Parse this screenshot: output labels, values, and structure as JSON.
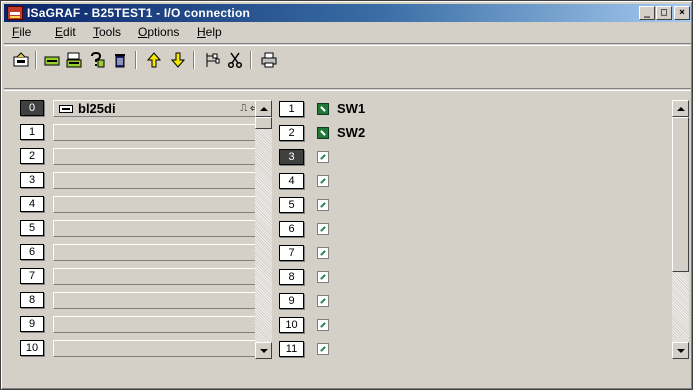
{
  "window": {
    "title": "ISaGRAF - B25TEST1 - I/O connection",
    "controls": {
      "minimize": "_",
      "maximize": "□",
      "close": "×"
    }
  },
  "menu": {
    "items": [
      {
        "label": "File",
        "underline": "F"
      },
      {
        "label": "Edit",
        "underline": "E"
      },
      {
        "label": "Tools",
        "underline": "T"
      },
      {
        "label": "Options",
        "underline": "O"
      },
      {
        "label": "Help",
        "underline": "H"
      }
    ]
  },
  "toolbar": {
    "icons": [
      "set-board-icon",
      "board-params-icon",
      "board-open-icon",
      "board-test-icon",
      "delete-icon",
      "move-up-icon",
      "move-down-icon",
      "hierarchy-icon",
      "cut-icon",
      "print-icon"
    ]
  },
  "slots": {
    "items": [
      {
        "number": "0",
        "selected": true,
        "board": "bl25di",
        "symbols": "⎍ ⇦"
      },
      {
        "number": "1"
      },
      {
        "number": "2"
      },
      {
        "number": "3"
      },
      {
        "number": "4"
      },
      {
        "number": "5"
      },
      {
        "number": "6"
      },
      {
        "number": "7"
      },
      {
        "number": "8"
      },
      {
        "number": "9"
      },
      {
        "number": "10"
      }
    ]
  },
  "channels": {
    "items": [
      {
        "number": "1",
        "name": "SW1",
        "type": "boolean"
      },
      {
        "number": "2",
        "name": "SW2",
        "type": "boolean"
      },
      {
        "number": "3",
        "name": "",
        "type": "empty",
        "selected": true
      },
      {
        "number": "4",
        "name": "",
        "type": "empty"
      },
      {
        "number": "5",
        "name": "",
        "type": "empty"
      },
      {
        "number": "6",
        "name": "",
        "type": "empty"
      },
      {
        "number": "7",
        "name": "",
        "type": "empty"
      },
      {
        "number": "8",
        "name": "",
        "type": "empty"
      },
      {
        "number": "9",
        "name": "",
        "type": "empty"
      },
      {
        "number": "10",
        "name": "",
        "type": "empty"
      },
      {
        "number": "11",
        "name": "",
        "type": "empty"
      }
    ]
  },
  "colors": {
    "title_start": "#0a246a",
    "title_end": "#a6caf0",
    "face": "#d4d0c8",
    "boolean_icon": "#1f7a3a"
  }
}
